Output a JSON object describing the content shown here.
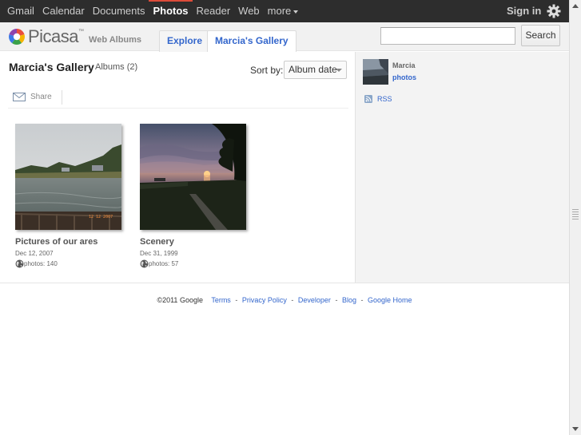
{
  "topbar": {
    "nav": [
      "Gmail",
      "Calendar",
      "Documents",
      "Photos",
      "Reader",
      "Web",
      "more"
    ],
    "active": "Photos",
    "signin": "Sign in",
    "gear_icon": "gear-icon"
  },
  "header": {
    "logo_word": "Picasa",
    "logo_tm": "™",
    "logo_sub": "Web Albums",
    "tabs": [
      {
        "label": "Explore"
      },
      {
        "label": "Marcia's Gallery"
      }
    ],
    "search_value": "",
    "search_button": "Search"
  },
  "main": {
    "title": "Marcia's Gallery",
    "albums_count": "Albums (2)",
    "sort_label": "Sort by:",
    "sort_value": "Album date",
    "share_label": "Share",
    "albums": [
      {
        "title": "Pictures of our ares",
        "date": "Dec 12, 2007",
        "photos": "photos: 140",
        "visibility_icon": "globe-icon"
      },
      {
        "title": "Scenery",
        "date": "Dec 31, 1999",
        "photos": "photos: 57",
        "visibility_icon": "globe-icon"
      }
    ]
  },
  "sidebar": {
    "user_name": "Marcia",
    "user_link": "photos",
    "rss": "RSS"
  },
  "footer": {
    "copyright": "©2011 Google",
    "links": [
      "Terms",
      "Privacy Policy",
      "Developer",
      "Blog",
      "Google Home"
    ],
    "separator": "-"
  },
  "colors": {
    "link": "#3366cc",
    "active_bar": "#dd4b39",
    "topbar": "#2d2d2d"
  }
}
